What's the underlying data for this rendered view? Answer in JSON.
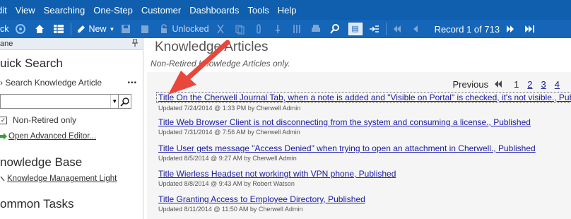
{
  "menubar": {
    "items": [
      "dit",
      "View",
      "Searching",
      "One-Step",
      "Customer",
      "Dashboards",
      "Tools",
      "Help"
    ]
  },
  "toolbar": {
    "back_label": "ck",
    "new_label": "New",
    "unlocked_label": "Unlocked",
    "record_text": "Record 1 of 713"
  },
  "left_pane": {
    "header": "ane",
    "quick_search_title": "uick Search",
    "search_label": "Search Knowledge Article",
    "more_label": "•••",
    "search_value": "",
    "non_retired_label": "Non-Retired only",
    "advanced_editor_label": "Open Advanced Editor...",
    "kb_title": "nowledge Base",
    "kb_link": "Knowledge Management Light",
    "common_tasks_title": "ommon Tasks"
  },
  "main": {
    "title": "Knowledge Articles",
    "subtitle": "Non-Retired Knowledge Articles only.",
    "pager": {
      "previous_label": "Previous",
      "pages": [
        "1",
        "2",
        "3",
        "4"
      ]
    },
    "articles": [
      {
        "title": "Title On the Cherwell Journal Tab, when a note is added and \"Visible on Portal\" is checked, it's not visible., Published",
        "meta": "Updated 7/24/2014 @ 1:33 PM by Cherwell Admin"
      },
      {
        "title": "Title Web Browser Client is not disconnecting from the system and consuming a license., Published",
        "meta": "Updated 7/31/2014 @ 7:56 AM by Cherwell Admin"
      },
      {
        "title": "Title User gets message \"Access Denied\" when trying to open an attachment in Cherwell., Published",
        "meta": "Updated 8/5/2014 @ 9:27 AM by Cherwell Admin"
      },
      {
        "title": "Title Wierless Headset not workingt with VPN phone, Published",
        "meta": "Updated 8/8/2014 @ 9:43 AM by Robert Watson"
      },
      {
        "title": "Title Granting Access to Employee Directory, Published",
        "meta": "Updated 8/11/2014 @ 11:50 AM by Cherwell Admin"
      }
    ]
  },
  "colors": {
    "menubar": "#0f5fae",
    "toolbar": "#1565b8",
    "link": "#1a1aa6",
    "arrow": "#e8473b"
  }
}
